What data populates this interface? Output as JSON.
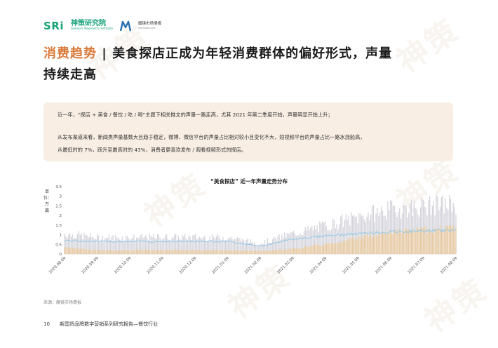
{
  "header": {
    "sri_logo_text": "SRi",
    "sri_cn": "神策研究院",
    "sri_en": "Sensors Research Institute",
    "partner_cn": "魔镜市场情报",
    "partner_en": "mktindex.com"
  },
  "page_title": {
    "highlight": "消费趋势",
    "separator": "|",
    "rest_line1": "美食探店正成为年轻消费群体的偏好形式，声量",
    "rest_line2": "持续走高"
  },
  "description": {
    "line1": "近一年，“探店 + 美食 / 餐饮 / 吃 / 喝”主题下相关推文的声量一路走高，尤其 2021 年第二季度开始，声量明显开始上升；",
    "line2": "从发布渠道来看，新闻类声量基数大且趋于稳定，微博、微信平台的声量占比相对较小且变化不大，短视频平台的声量占比一路水涨船高，",
    "line3": "从最低时的 7%，跃升至最高时的 43%，消费者更喜欢发布 / 观看视频形式的探店。"
  },
  "chart_unit": "单位：万篇",
  "source": "来源：魔镜市场情报",
  "footer": {
    "page_number": "10",
    "report_title": "新国货品牌数字营销系列研究报告—餐饮行业"
  },
  "colors": {
    "accent": "#d97a3a",
    "brand_green": "#1aa37a",
    "box_bg": "#f9eee4",
    "series_short_video": "#e8c9a0",
    "series_news": "#cfcfd8",
    "series_line": "#8ec7e6"
  },
  "chart_data": {
    "type": "bar",
    "title": "“美食探店” 近一年声量走势分布",
    "xlabel": "",
    "ylabel": "单位：万篇",
    "ylim": [
      0,
      3.5
    ],
    "yticks": [
      0,
      0.5,
      1,
      1.5,
      2,
      2.5,
      3,
      3.5
    ],
    "categories": [
      "2020.08.09",
      "2020.09.09",
      "2020.10.09",
      "2020.11.09",
      "2020.12.09",
      "2021.01.09",
      "2021.02.09",
      "2021.03.09",
      "2021.04.09",
      "2021.05.09",
      "2021.06.09",
      "2021.07.09",
      "2021.08.09"
    ],
    "series": [
      {
        "values": [
          1.05,
          0.85,
          0.85,
          0.87,
          0.86,
          0.86,
          0.55,
          1.05,
          1.45,
          1.9,
          2.3,
          2.45,
          2.6
        ]
      },
      {
        "values": [
          0.7,
          0.65,
          0.65,
          0.65,
          0.66,
          0.66,
          0.4,
          0.78,
          0.95,
          1.05,
          1.15,
          1.2,
          1.25
        ]
      },
      {
        "values": [
          0.35,
          0.2,
          0.2,
          0.22,
          0.2,
          0.2,
          0.15,
          0.27,
          0.5,
          0.85,
          1.15,
          1.25,
          1.35
        ]
      }
    ],
    "grid": false,
    "legend": "none"
  }
}
